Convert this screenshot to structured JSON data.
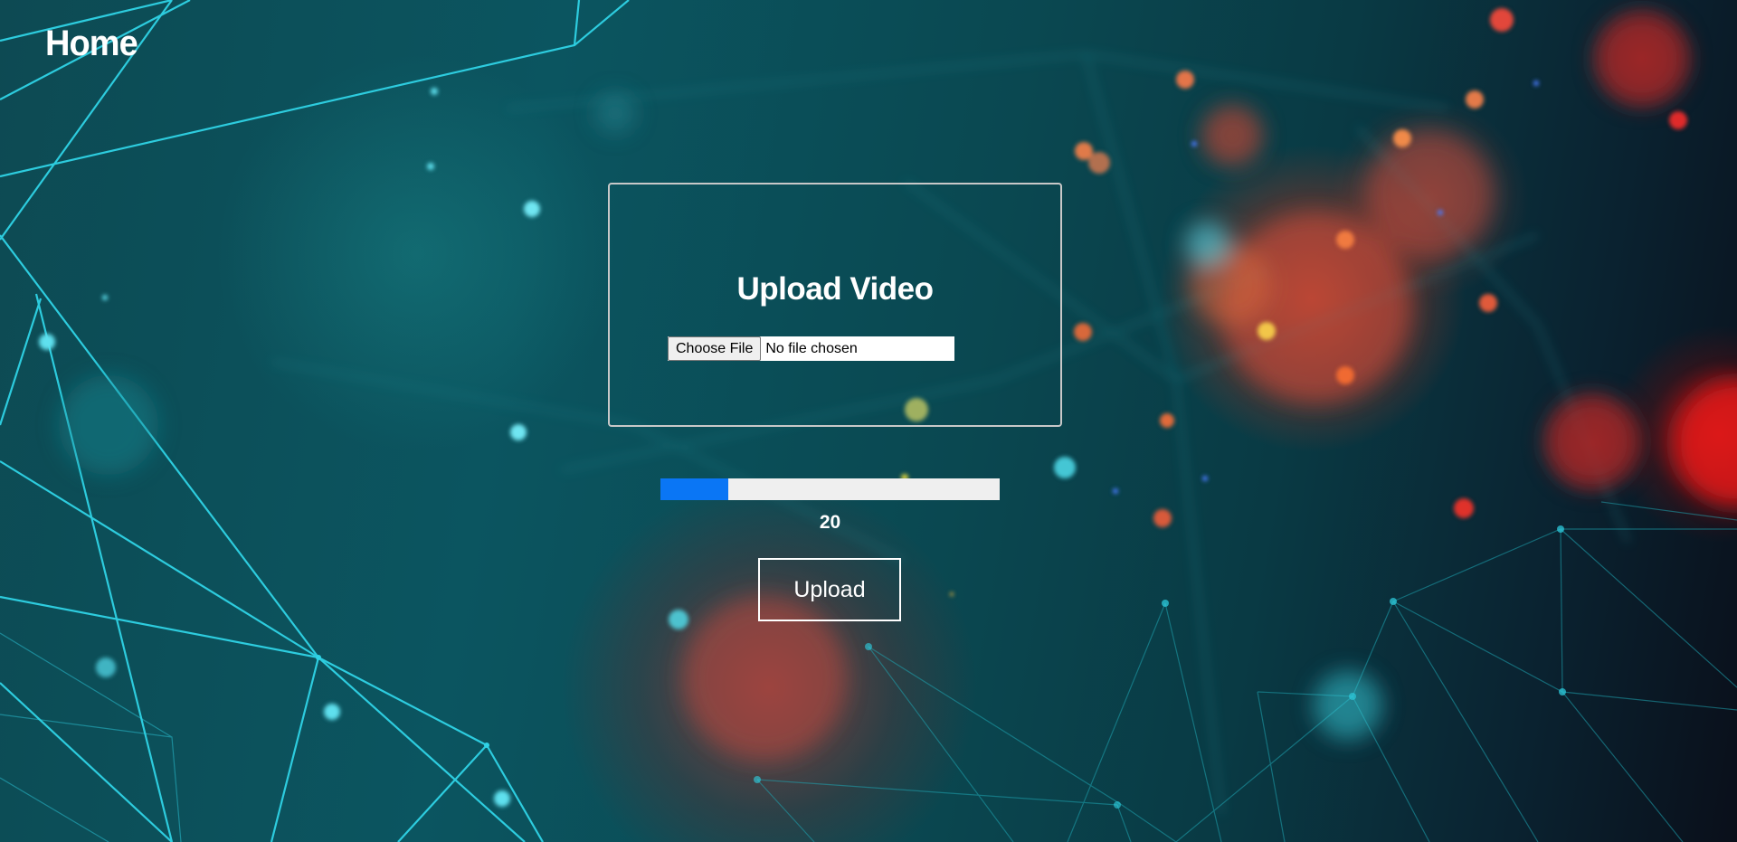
{
  "nav": {
    "home_label": "Home"
  },
  "upload_card": {
    "title": "Upload Video",
    "file_input": {
      "button_label": "Choose File",
      "status_text": "No file chosen"
    }
  },
  "progress": {
    "value": 20,
    "value_label": "20",
    "max": 100,
    "fill_color": "#0a76f5",
    "track_color": "#efefef"
  },
  "actions": {
    "upload_label": "Upload"
  },
  "colors": {
    "text": "#ffffff",
    "card_border": "#c8c8c8",
    "network_lines": "#2fd3e6",
    "bokeh_red": "#c0392b"
  }
}
